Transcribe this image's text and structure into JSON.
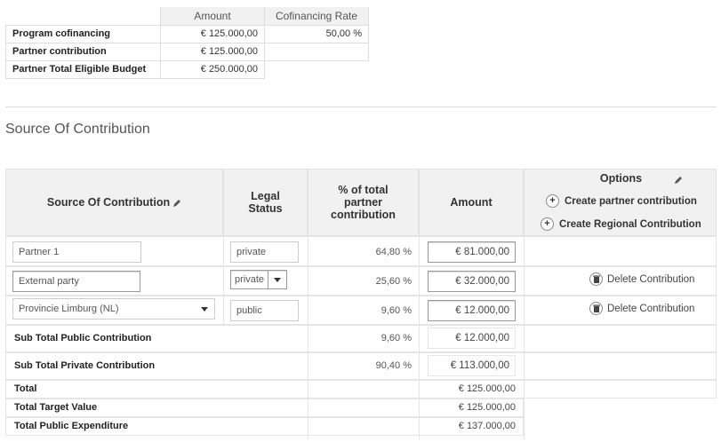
{
  "summary": {
    "headers": [
      "Amount",
      "Cofinancing Rate"
    ],
    "rows": [
      {
        "label": "Program cofinancing",
        "amount": "€ 125.000,00",
        "rate": "50,00 %"
      },
      {
        "label": "Partner contribution",
        "amount": "€ 125.000,00",
        "rate": ""
      },
      {
        "label": "Partner Total Eligible Budget",
        "amount": "€ 250.000,00"
      }
    ]
  },
  "section_title": "Source Of Contribution",
  "table": {
    "headers": {
      "source": "Source Of Contribution",
      "legal_status": "Legal Status",
      "percent": "% of total partner contribution",
      "amount": "Amount",
      "options": "Options"
    },
    "options": {
      "create_partner": "Create partner contribution",
      "create_regional": "Create Regional Contribution"
    },
    "rows": [
      {
        "source": "Partner 1",
        "legal_status": "private",
        "percent": "64,80 %",
        "amount": "€ 81.000,00",
        "action": ""
      },
      {
        "source": "External party",
        "legal_status": "private",
        "percent": "25,60 %",
        "amount": "€ 32.000,00",
        "action": "Delete Contribution"
      },
      {
        "source": "Provincie Limburg (NL)",
        "legal_status": "public",
        "percent": "9,60 %",
        "amount": "€ 12.000,00",
        "action": "Delete Contribution"
      }
    ],
    "subtotals": [
      {
        "label": "Sub Total Public Contribution",
        "percent": "9,60 %",
        "amount": "€ 12.000,00"
      },
      {
        "label": "Sub Total Private Contribution",
        "percent": "90,40 %",
        "amount": "€ 113.000,00"
      }
    ],
    "totals": [
      {
        "label": "Total",
        "amount": "€ 125.000,00"
      },
      {
        "label": "Total Target Value",
        "amount": "€ 125.000,00"
      },
      {
        "label": "Total Public Expenditure",
        "amount": "€ 137.000,00"
      }
    ]
  }
}
